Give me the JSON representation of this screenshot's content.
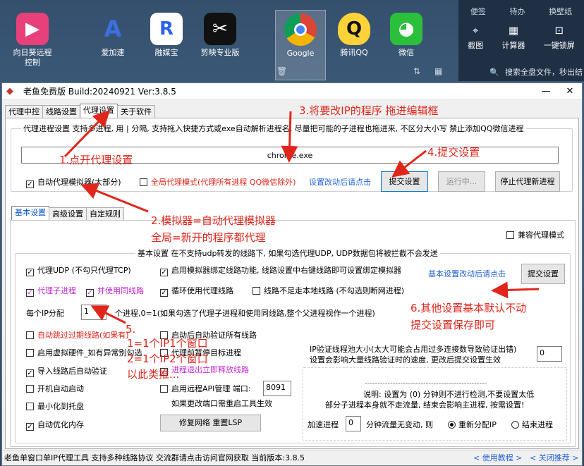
{
  "desktop": {
    "icons": [
      {
        "label": "向日葵远程\n控制",
        "icon": "sunflower-remote-icon",
        "color": "#e8407a",
        "glyph": "▶"
      },
      {
        "label": "爱加速",
        "icon": "rocket-icon",
        "color": "#3c6fe0",
        "glyph": "A"
      },
      {
        "label": "融媒宝",
        "icon": "rongmeibao-icon",
        "color": "#2b62e8",
        "glyph": "R"
      },
      {
        "label": "剪映专业版",
        "icon": "capcut-icon",
        "color": "#111111",
        "glyph": "✂"
      },
      {
        "label": "Google",
        "icon": "chrome-icon",
        "color": "#ffffff",
        "glyph": "◉"
      },
      {
        "label": "腾讯QQ",
        "icon": "qq-penguin-icon",
        "color": "#1a1a1a",
        "glyph": "Q"
      },
      {
        "label": "微信",
        "icon": "wechat-icon",
        "color": "#2cbf3c",
        "glyph": "◕"
      }
    ],
    "right_panel": {
      "header": [
        "便签",
        "待办",
        "换壁纸"
      ],
      "tools": [
        {
          "label": "截图",
          "icon": "screenshot-icon",
          "glyph": "⌖"
        },
        {
          "label": "计算器",
          "icon": "calculator-icon",
          "glyph": "▦"
        },
        {
          "label": "一键锁屏",
          "icon": "lock-icon",
          "glyph": "🔒"
        }
      ],
      "search": "搜索全盘文件，秒出结"
    }
  },
  "window": {
    "title": "老鱼免费版 Build:20240921 Ver:3.8.5",
    "controls": {
      "minimize": "—",
      "close": "✕"
    },
    "tabs": [
      "代理中控",
      "线路设置",
      "代理设置",
      "关于软件"
    ],
    "active_tab": 2,
    "process_group": {
      "legend": "代理进程设置 支持多进程, 用 | 分隔, 支持拖入快捷方式或exe自动解析进程名, 尽量把可能的子进程也拖进来, 不区分大小写 禁止添加QQ微信进程",
      "process_value": "chrome.exe",
      "auto_proxy_label": "自动代理模拟器(大部分)",
      "auto_proxy_checked": true,
      "global_mode_label": "全局代理模式(代理所有进程 QQ微信除外)",
      "global_mode_checked": false,
      "restart_hint": "设置改动后请点击",
      "submit_label": "提交设置",
      "running_label": "运行中...",
      "stop_label": "停止代理新进程"
    },
    "sub_tabs": [
      "基本设置",
      "高级设置",
      "自定规则"
    ],
    "compat_mode_label": "兼容代理模式",
    "basic": {
      "legend": "基本设置 在不支持udp转发的线路下, 如果勾选代理UDP, UDP数据包将被拦截不会发送",
      "proxy_udp": "代理UDP (不勾只代理TCP)",
      "bind_route": "启用模拟器绑定线路功能, 线路设置中右键线路即可设置绑定模拟器",
      "proxy_child": "代理子进程",
      "use_same_route": "并使用同线路",
      "cycle_route": "循环使用代理线路",
      "no_local_route": "线路不足走本地线路 (不勾选则断网进程)",
      "per_ip_prefix": "每个IP分配",
      "per_ip_value": "1",
      "per_ip_suffix": "个进程,0=1(如果勾选了代理子进程和使用同线路,整个父进程视作一个进程)",
      "basic_hint": "基本设置改动后请点击",
      "submit_label": "提交设置",
      "auto_skip": "自动跳过过期线路(如果有)",
      "verify_on_start": "启动后自动验证所有线路",
      "virtual_hw": "启用虚拟硬件_如有异常别勾选",
      "pause_target": "代理前暂停目标进程",
      "import_verify": "导入线路后自动验证",
      "release_on_exit": "进程退出立即释放线路",
      "autostart": "开机自动启动",
      "remote_api": "启用远程API管理 端口:",
      "api_port": "8091",
      "minimize_tray": "最小化到托盘",
      "port_hint": "如果更改端口需重启工具生效",
      "auto_opt_mem": "自动优化内存",
      "repair_label": "修复网络 重置LSP",
      "pool_title": "IP验证线程池大小(太大可能会占用过多连接数导致验证出错)",
      "pool_sub": "设置会影响大量线路验证时的速度, 更改后提交设置生效",
      "pool_value": "0",
      "note_dash": "------------------------------------------------",
      "note1": "说明: 设置为 (0) 分钟则不进行检测,不要设置太低",
      "note2": "部分子进程本身就不走流量, 结束会影响主进程, 按需设置!",
      "accel_prefix": "加速进程",
      "accel_value": "0",
      "accel_suffix": "分钟流量无变动, 则",
      "realloc_label": "重新分配IP",
      "end_proc_label": "结束进程"
    },
    "status": {
      "text": "老鱼单窗口单IP代理工具 支持多种线路协议 交流群请点击访问官网获取   当前版本:3.8.5",
      "tutorial": "< 使用教程 >",
      "recommend": "< 关闭推荐 >"
    }
  },
  "annotations": {
    "a1": "1.点开代理设置",
    "a2_line1": "2.模拟器=自动代理模拟器",
    "a2_line2": "全局=新开的程序都代理",
    "a3": "3.将要改IP的程序 拖进编辑框",
    "a4": "4.提交设置",
    "a5": "5.",
    "a5_line1": "1=1个IP1个窗口",
    "a5_line2": "2=1个IP2个窗口",
    "a5_line3": "以此类推...",
    "a6_line1": "6.其他设置基本默认不动",
    "a6_line2": "提交设置保存即可",
    "color": "#e0261b"
  }
}
